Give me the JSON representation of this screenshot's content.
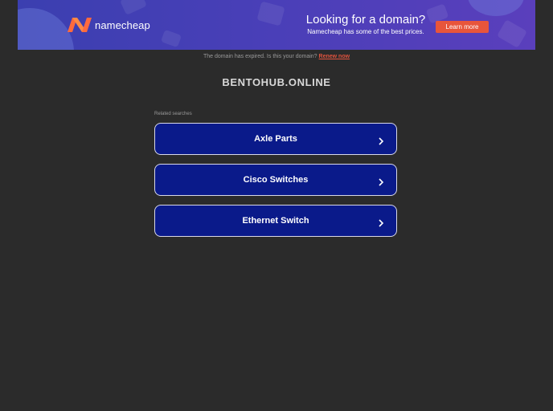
{
  "banner": {
    "logo_text": "namecheap",
    "promo_title": "Looking for a domain?",
    "promo_subtitle": "Namecheap has some of the best prices.",
    "learn_more_label": "Learn more",
    "accent_color": "#e8553b"
  },
  "notice": {
    "text": "The domain has expired. Is this your domain?",
    "renew_label": "Renew now"
  },
  "domain": {
    "title": "BENTOHUB.ONLINE"
  },
  "related": {
    "label": "Related searches",
    "items": [
      {
        "label": "Axle Parts",
        "icon": "chevron-right-icon"
      },
      {
        "label": "Cisco Switches",
        "icon": "chevron-right-icon"
      },
      {
        "label": "Ethernet Switch",
        "icon": "chevron-right-icon"
      }
    ]
  }
}
